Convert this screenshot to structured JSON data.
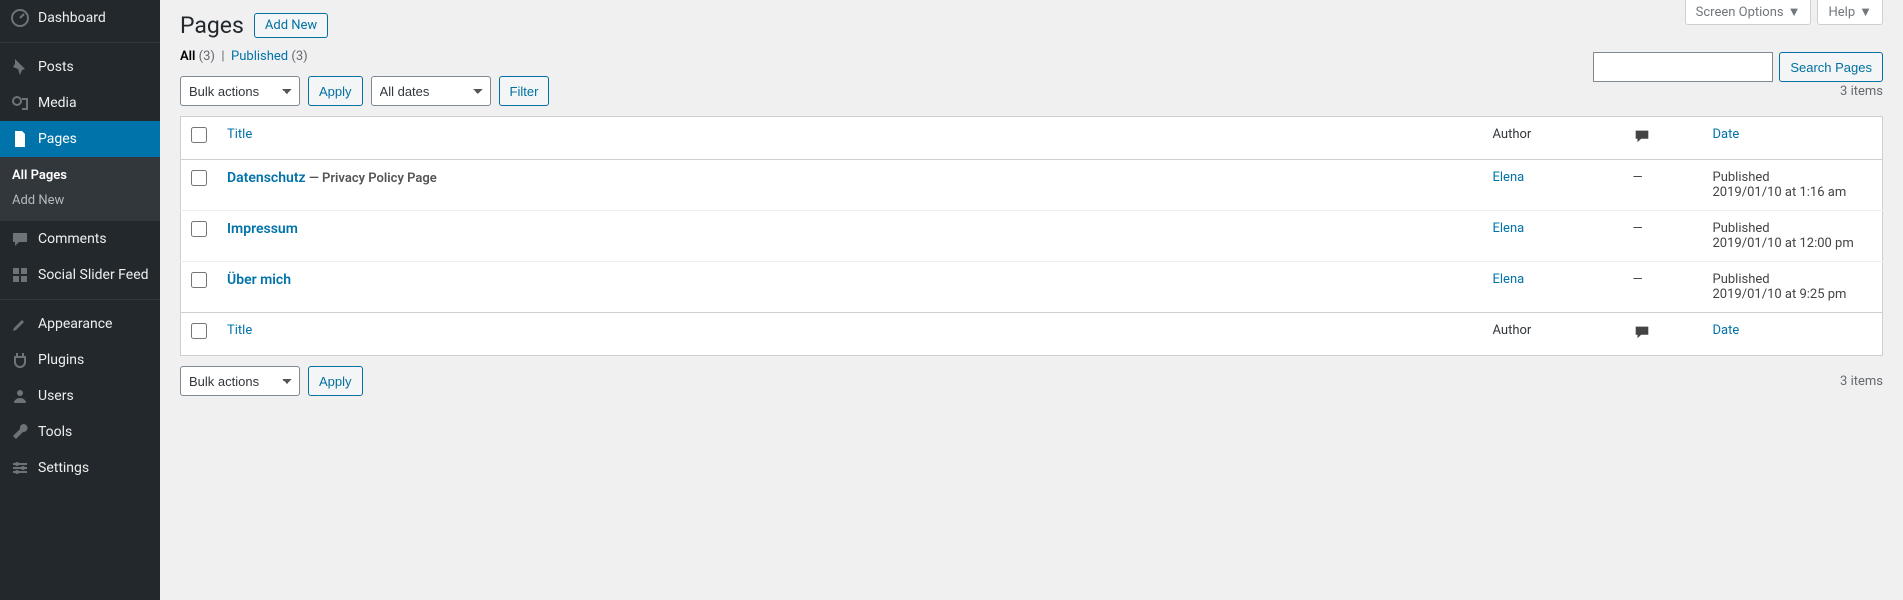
{
  "screen_meta": {
    "screen_options": "Screen Options",
    "help": "Help"
  },
  "sidebar": {
    "items": [
      {
        "label": "Dashboard",
        "icon": "dashboard"
      },
      {
        "label": "Posts",
        "icon": "pin"
      },
      {
        "label": "Media",
        "icon": "media"
      },
      {
        "label": "Pages",
        "icon": "page",
        "current": true
      },
      {
        "label": "Comments",
        "icon": "comment"
      },
      {
        "label": "Social Slider Feed",
        "icon": "grid"
      },
      {
        "label": "Appearance",
        "icon": "brush"
      },
      {
        "label": "Plugins",
        "icon": "plug"
      },
      {
        "label": "Users",
        "icon": "user"
      },
      {
        "label": "Tools",
        "icon": "wrench"
      },
      {
        "label": "Settings",
        "icon": "settings"
      }
    ],
    "submenu": [
      {
        "label": "All Pages",
        "current": true
      },
      {
        "label": "Add New"
      }
    ]
  },
  "header": {
    "title": "Pages",
    "add_new": "Add New"
  },
  "filters": {
    "all_label": "All",
    "all_count": "(3)",
    "published_label": "Published",
    "published_count": "(3)"
  },
  "search": {
    "button": "Search Pages"
  },
  "bulk": {
    "select_label": "Bulk actions",
    "apply": "Apply"
  },
  "datefilter": {
    "select_label": "All dates",
    "filter": "Filter"
  },
  "pagination": {
    "label": "3 items"
  },
  "columns": {
    "title": "Title",
    "author": "Author",
    "date": "Date"
  },
  "rows": [
    {
      "title": "Datenschutz",
      "state": " — Privacy Policy Page",
      "author": "Elena",
      "comments": "—",
      "status": "Published",
      "date": "2019/01/10 at 1:16 am"
    },
    {
      "title": "Impressum",
      "state": "",
      "author": "Elena",
      "comments": "—",
      "status": "Published",
      "date": "2019/01/10 at 12:00 pm"
    },
    {
      "title": "Über mich",
      "state": "",
      "author": "Elena",
      "comments": "—",
      "status": "Published",
      "date": "2019/01/10 at 9:25 pm"
    }
  ]
}
